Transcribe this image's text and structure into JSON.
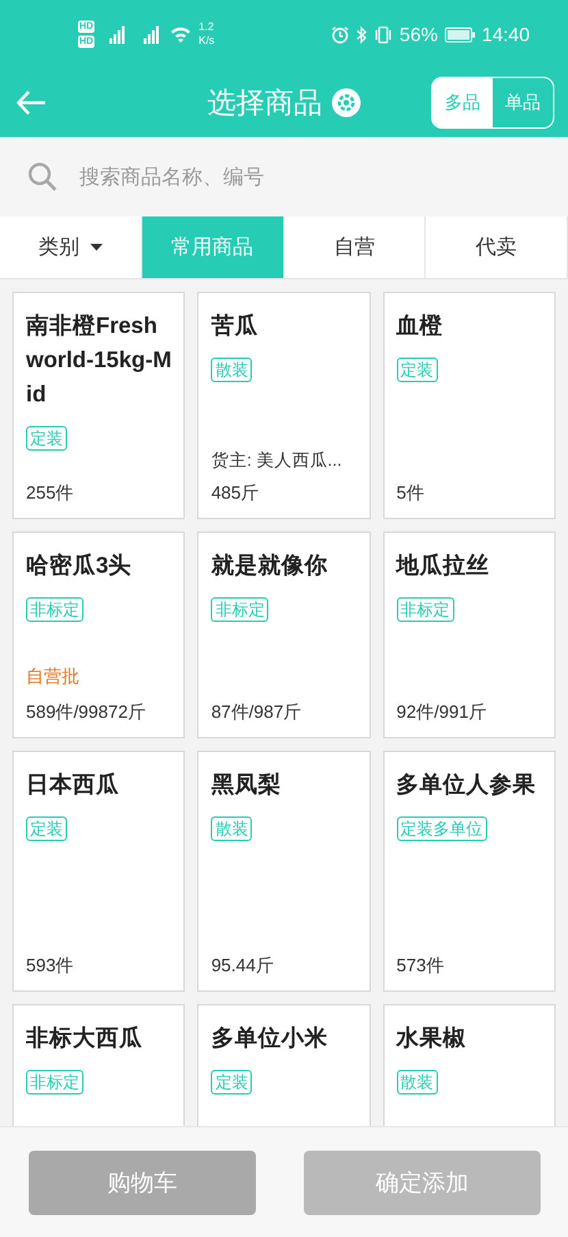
{
  "status_bar": {
    "hd_labels": [
      "HD",
      "HD"
    ],
    "net_speed": [
      "1.2",
      "K/s"
    ],
    "battery": "56%",
    "time": "14:40"
  },
  "header": {
    "title": "选择商品",
    "modes": [
      {
        "label": "多品",
        "selected": true
      },
      {
        "label": "单品",
        "selected": false
      }
    ]
  },
  "search": {
    "placeholder": "搜索商品名称、编号"
  },
  "tabs": [
    {
      "label": "类别",
      "kind": "dropdown",
      "selected": false
    },
    {
      "label": "常用商品",
      "kind": "tab",
      "selected": true
    },
    {
      "label": "自营",
      "kind": "tab",
      "selected": false
    },
    {
      "label": "代卖",
      "kind": "tab",
      "selected": false
    }
  ],
  "products": [
    {
      "name": "南非橙Freshworld-15kg-Mid",
      "tag": "定装",
      "count": "255件"
    },
    {
      "name": "苦瓜",
      "tag": "散装",
      "owner": "货主: 美人西瓜...",
      "count": "485斤"
    },
    {
      "name": "血橙",
      "tag": "定装",
      "count": "5件"
    },
    {
      "name": "哈密瓜3头",
      "tag": "非标定",
      "note": "自营批",
      "count": "589件/99872斤"
    },
    {
      "name": "就是就像你",
      "tag": "非标定",
      "count": "87件/987斤"
    },
    {
      "name": "地瓜拉丝",
      "tag": "非标定",
      "count": "92件/991斤"
    },
    {
      "name": "日本西瓜",
      "tag": "定装",
      "count": "593件"
    },
    {
      "name": "黑凤梨",
      "tag": "散装",
      "count": "95.44斤"
    },
    {
      "name": "多单位人参果",
      "tag": "定装多单位",
      "count": "573件"
    },
    {
      "name": "非标大西瓜",
      "tag": "非标定"
    },
    {
      "name": "多单位小米",
      "tag": "定装"
    },
    {
      "name": "水果椒",
      "tag": "散装"
    }
  ],
  "buttons": [
    {
      "label": "购物车",
      "kind": "cart",
      "disabled": true
    },
    {
      "label": "确定添加",
      "kind": "confirm",
      "disabled": true
    }
  ]
}
